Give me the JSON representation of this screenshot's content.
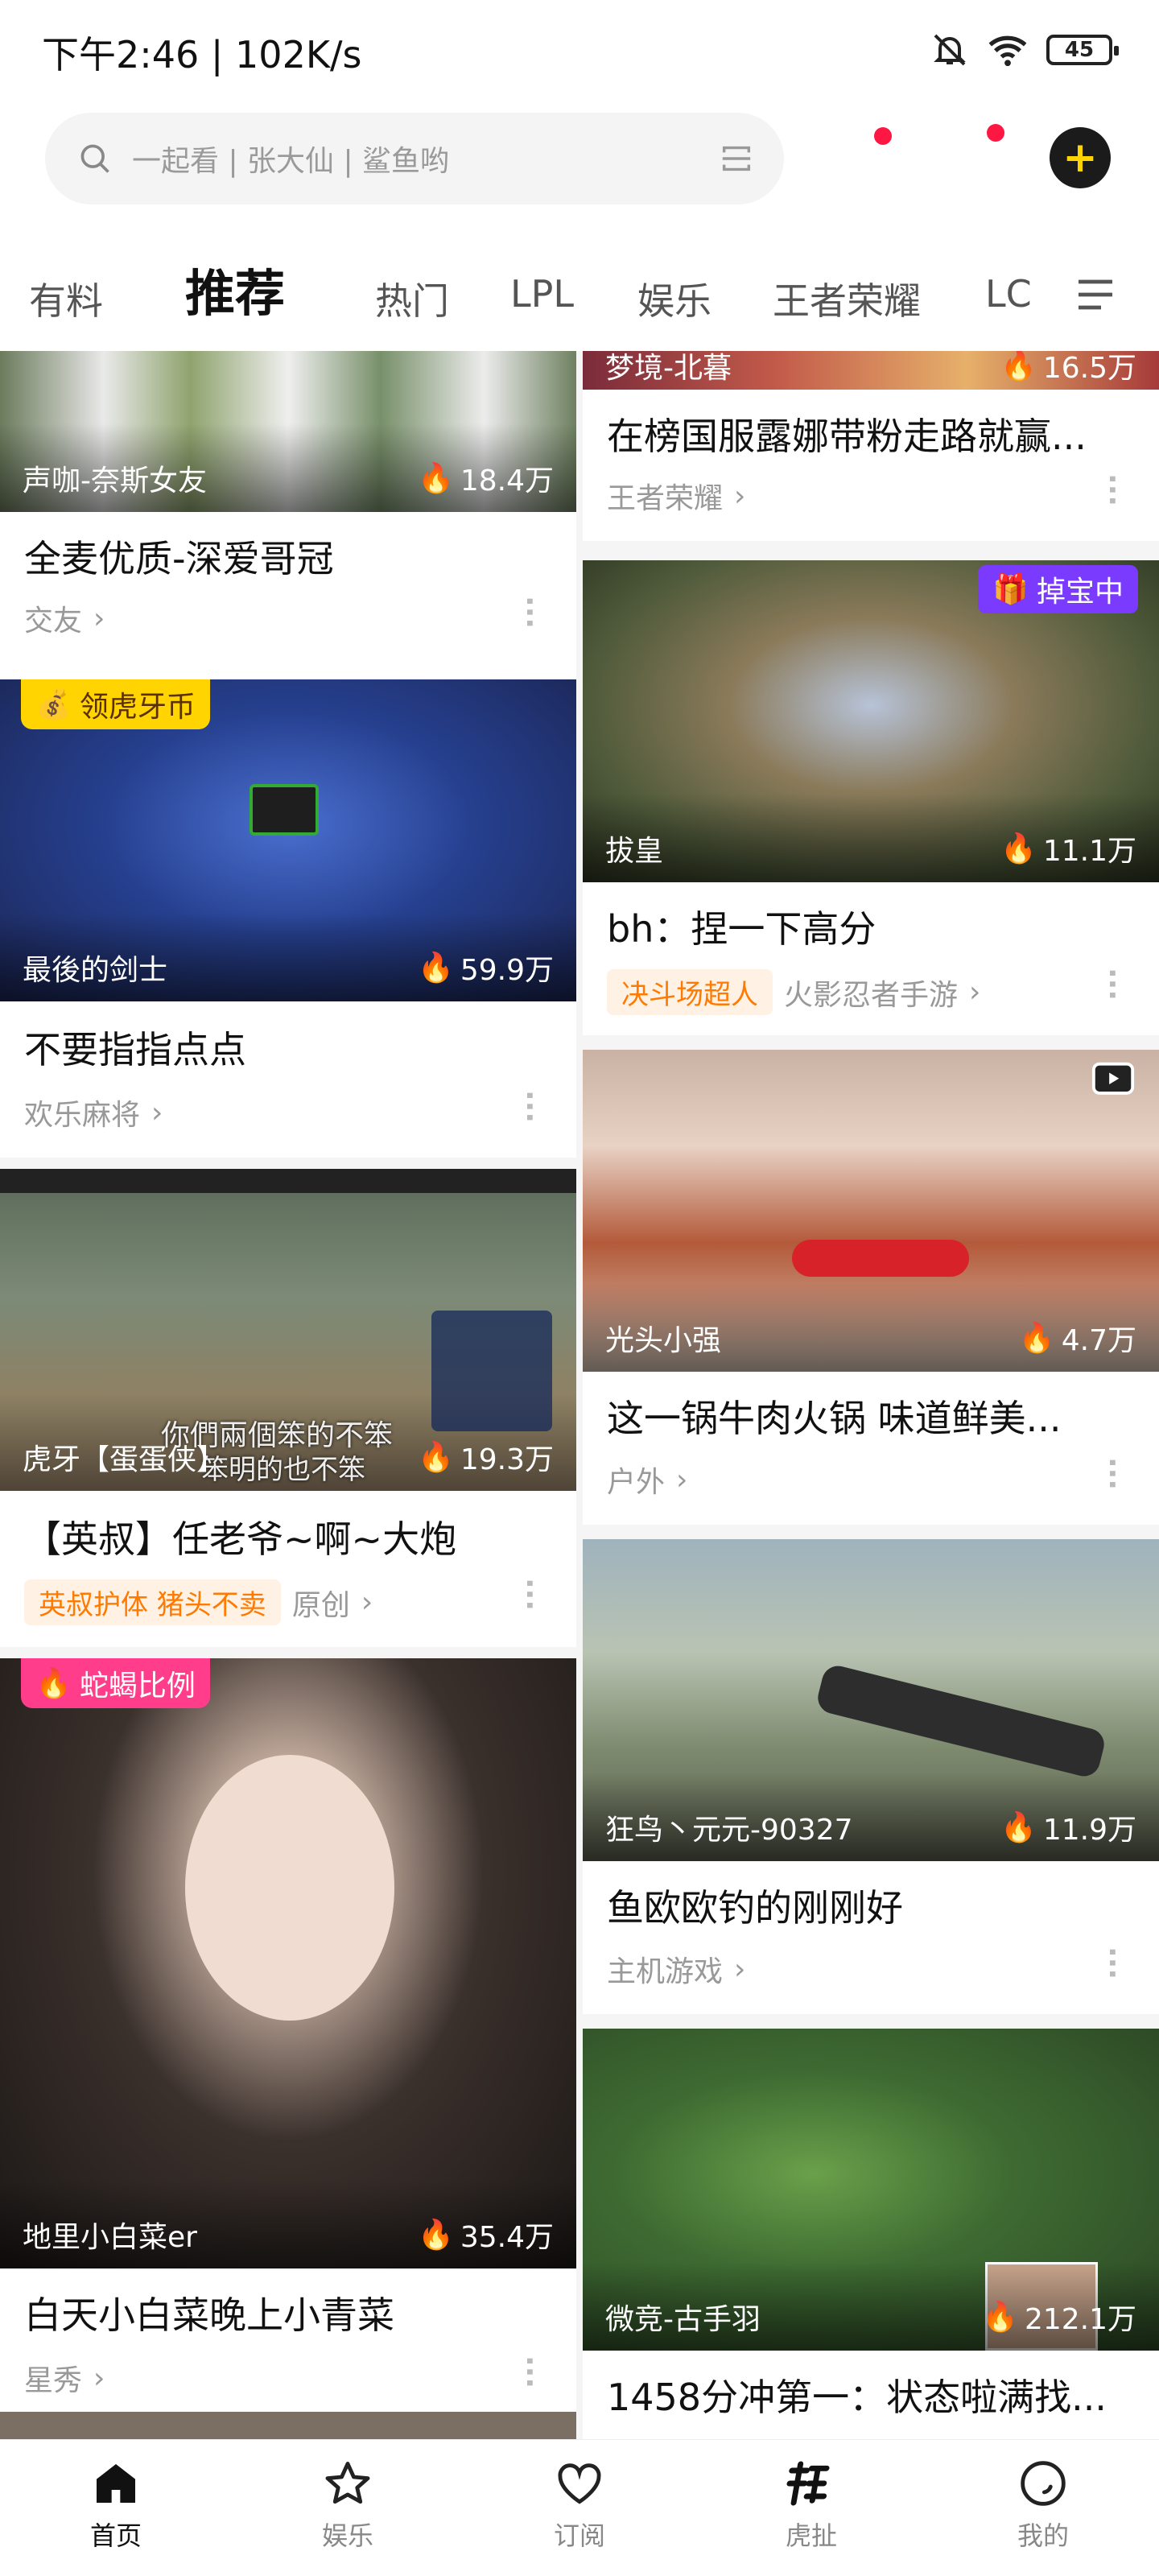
{
  "status": {
    "time": "下午2:46 | 102K/s",
    "battery": "45",
    "icons": [
      "mute-bell-icon",
      "wifi-icon",
      "battery-icon"
    ]
  },
  "search": {
    "placeholder": "一起看 | 张大仙 | 鲨鱼哟"
  },
  "tabs": [
    "有料",
    "推荐",
    "热门",
    "LPL",
    "娱乐",
    "王者荣耀",
    "LC"
  ],
  "active_tab": "推荐",
  "left_cards": [
    {
      "anchor": "声咖-奈斯女友",
      "views": "18.4万",
      "title": "全麦优质-深爱哥冠",
      "category": "交友"
    },
    {
      "badge": "领虎牙币",
      "anchor": "最後的剑士",
      "views": "59.9万",
      "title": "不要指指点点",
      "category": "欢乐麻将"
    },
    {
      "anchor": "虎牙【蛋蛋侠】",
      "views": "19.3万",
      "title": "【英叔】任老爷~啊~大炮",
      "tags": [
        "英叔护体 猪头不卖"
      ],
      "category": "原创",
      "subtitle1": "你們兩個笨的不笨",
      "subtitle2": "笨明的也不笨"
    },
    {
      "badge": "蛇蝎比例",
      "anchor": "地里小白菜er",
      "views": "35.4万",
      "title": "白天小白菜晚上小青菜",
      "category": "星秀"
    }
  ],
  "right_cards": [
    {
      "anchor": "梦境-北暮",
      "views": "16.5万",
      "title": "在榜国服露娜带粉走路就赢...",
      "category": "王者荣耀"
    },
    {
      "badge": "掉宝中",
      "anchor": "拔皇",
      "views": "11.1万",
      "title": "bh：捏一下高分",
      "tags": [
        "决斗场超人"
      ],
      "category": "火影忍者手游"
    },
    {
      "anchor": "光头小强",
      "views": "4.7万",
      "title": "这一锅牛肉火锅 味道鲜美...",
      "category": "户外"
    },
    {
      "anchor": "狂鸟丶元元-90327",
      "views": "11.9万",
      "title": "鱼欧欧钓的刚刚好",
      "category": "主机游戏"
    },
    {
      "anchor": "微竞-古手羽",
      "views": "212.1万",
      "title": "1458分冲第一：状态啦满找..."
    }
  ],
  "nav": [
    "首页",
    "娱乐",
    "订阅",
    "虎扯",
    "我的"
  ],
  "colors": {
    "accent": "#ffd400",
    "notify_dot": "#ff1744",
    "tag_text": "#ff7a00",
    "tag_bg": "#fff2e4",
    "badge_purple": "#7b3bff"
  }
}
